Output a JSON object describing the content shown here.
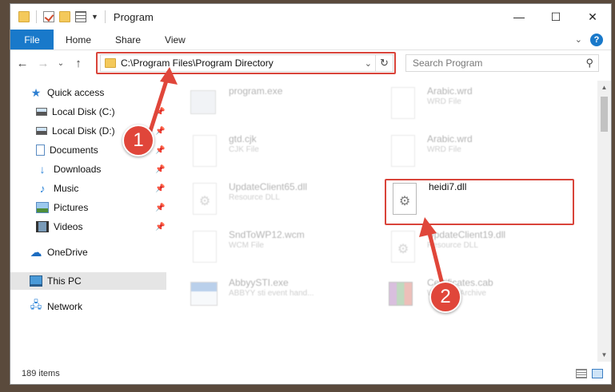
{
  "window": {
    "title": "Program"
  },
  "ribbon": {
    "file": "File",
    "tabs": [
      "Home",
      "Share",
      "View"
    ]
  },
  "address": {
    "path": "C:\\Program Files\\Program Directory"
  },
  "search": {
    "placeholder": "Search Program"
  },
  "sidebar": {
    "items": [
      {
        "label": "Quick access",
        "icon": "star-icon"
      },
      {
        "label": "Local Disk (C:)",
        "icon": "drive-icon"
      },
      {
        "label": "Local Disk (D:)",
        "icon": "drive-icon"
      },
      {
        "label": "Documents",
        "icon": "documents-icon"
      },
      {
        "label": "Downloads",
        "icon": "download-icon"
      },
      {
        "label": "Music",
        "icon": "music-icon"
      },
      {
        "label": "Pictures",
        "icon": "pictures-icon"
      },
      {
        "label": "Videos",
        "icon": "videos-icon"
      },
      {
        "label": "OneDrive",
        "icon": "cloud-icon"
      },
      {
        "label": "This PC",
        "icon": "computer-icon"
      },
      {
        "label": "Network",
        "icon": "network-icon"
      }
    ]
  },
  "files": [
    {
      "name": "program.exe",
      "type": ""
    },
    {
      "name": "Arabic.wrd",
      "type": "WRD File"
    },
    {
      "name": "gtd.cjk",
      "type": "CJK File"
    },
    {
      "name": "Arabic.wrd",
      "type": "WRD File"
    },
    {
      "name": "UpdateClient65.dll",
      "type": "Resource DLL"
    },
    {
      "name": "heidi7.dll",
      "type": ""
    },
    {
      "name": "SndToWP12.wcm",
      "type": "WCM File"
    },
    {
      "name": "UpdateClient19.dll",
      "type": "Resource DLL"
    },
    {
      "name": "AbbyySTI.exe",
      "type": "ABBYY sti event hand..."
    },
    {
      "name": "Certificates.cab",
      "type": "WinRAR Archive"
    }
  ],
  "status": {
    "count": "189 items"
  },
  "callouts": {
    "one": "1",
    "two": "2"
  },
  "colors": {
    "accent": "#1979ca",
    "highlight": "#d9443a"
  }
}
